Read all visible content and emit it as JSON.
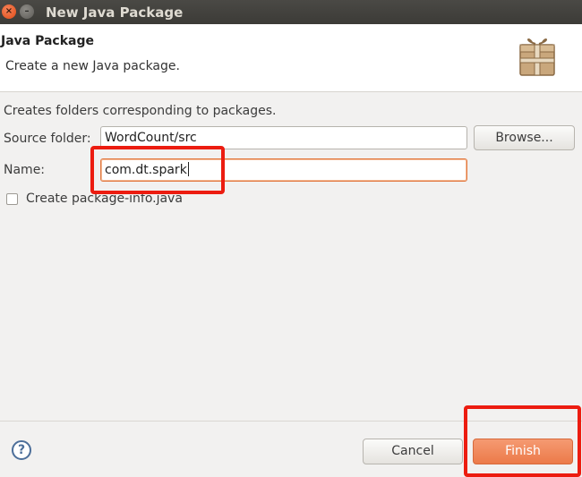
{
  "window": {
    "title": "New Java Package",
    "close_glyph": "×",
    "minimize_glyph": "–"
  },
  "header": {
    "title": "Java Package",
    "description": "Create a new Java package.",
    "icon": "package-icon"
  },
  "content": {
    "description": "Creates folders corresponding to packages.",
    "source_folder": {
      "label": "Source folder:",
      "value": "WordCount/src",
      "browse_label": "Browse..."
    },
    "name": {
      "label": "Name:",
      "value": "com.dt.spark"
    },
    "package_info": {
      "label": "Create package-info.java",
      "checked": false
    }
  },
  "footer": {
    "help_glyph": "?",
    "cancel_label": "Cancel",
    "finish_label": "Finish"
  },
  "colors": {
    "accent": "#ec7a49",
    "annotation": "#ec1c10",
    "titlebar": "#3c3b37"
  }
}
